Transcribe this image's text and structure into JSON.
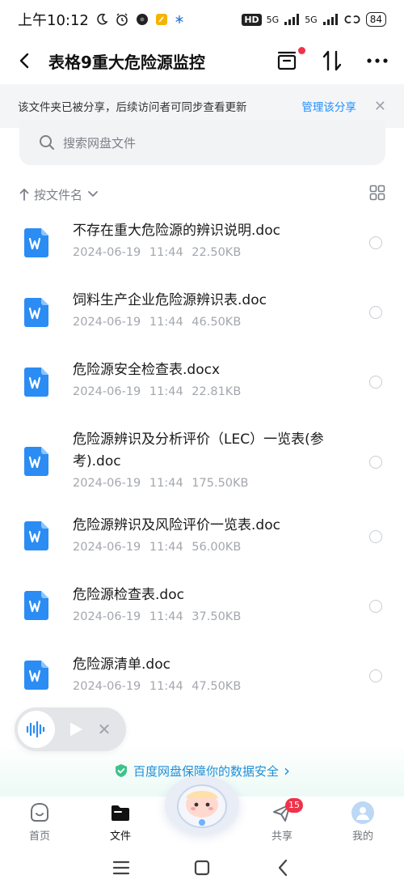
{
  "status_bar": {
    "time": "上午10:12",
    "hd_label": "HD",
    "net1": "5G",
    "net2": "5G",
    "battery": "84"
  },
  "nav": {
    "title": "表格9重大危险源监控"
  },
  "share_notice": {
    "text": "该文件夹已被分享，后续访问者可同步查看更新",
    "manage_label": "管理该分享",
    "close_glyph": "✕"
  },
  "search": {
    "placeholder": "搜索网盘文件"
  },
  "sort": {
    "label": "按文件名"
  },
  "files": [
    {
      "name": "不存在重大危险源的辨识说明.doc",
      "date": "2024-06-19",
      "time": "11:44",
      "size": "22.50KB"
    },
    {
      "name": "饲料生产企业危险源辨识表.doc",
      "date": "2024-06-19",
      "time": "11:44",
      "size": "46.50KB"
    },
    {
      "name": "危险源安全检查表.docx",
      "date": "2024-06-19",
      "time": "11:44",
      "size": "22.81KB"
    },
    {
      "name": "危险源辨识及分析评价（LEC）一览表(参考).doc",
      "date": "2024-06-19",
      "time": "11:44",
      "size": "175.50KB"
    },
    {
      "name": "危险源辨识及风险评价一览表.doc",
      "date": "2024-06-19",
      "time": "11:44",
      "size": "56.00KB"
    },
    {
      "name": "危险源检查表.doc",
      "date": "2024-06-19",
      "time": "11:44",
      "size": "37.50KB"
    },
    {
      "name": "危险源清单.doc",
      "date": "2024-06-19",
      "time": "11:44",
      "size": "47.50KB"
    }
  ],
  "voice_pill": {
    "close_glyph": "✕"
  },
  "security_banner": {
    "text": "百度网盘保障你的数据安全",
    "chevron": "›"
  },
  "tabs": [
    {
      "label": "首页",
      "icon": "home-icon"
    },
    {
      "label": "文件",
      "icon": "folder-icon"
    },
    {
      "label": "共享",
      "icon": "share-plane-icon",
      "badge": "15"
    },
    {
      "label": "我的",
      "icon": "avatar-icon"
    }
  ],
  "colors": {
    "accent": "#1f8fff",
    "word_icon": "#2b8cf3",
    "badge": "#f0324b",
    "banner_text": "#1e8fd8"
  }
}
